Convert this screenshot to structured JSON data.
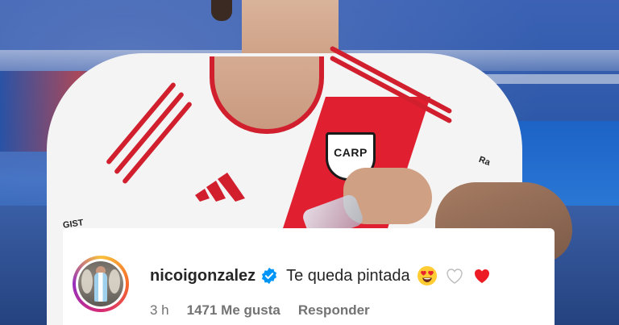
{
  "photo": {
    "sponsor_left": "GIST",
    "sponsor_right": "Ra",
    "crest_text": "CARP"
  },
  "comment": {
    "username": "nicoigonzalez",
    "verified": true,
    "text": "Te queda pintada",
    "emojis": [
      "heart-eyes-emoji",
      "white-heart-emoji",
      "red-heart-emoji"
    ],
    "time": "3 h",
    "likes": "1471 Me gusta",
    "reply_label": "Responder"
  },
  "colors": {
    "verified_blue": "#0095f6",
    "text_primary": "#262626",
    "text_secondary": "#737373",
    "red_heart": "#ed1c24",
    "jersey_red": "#e02030"
  }
}
